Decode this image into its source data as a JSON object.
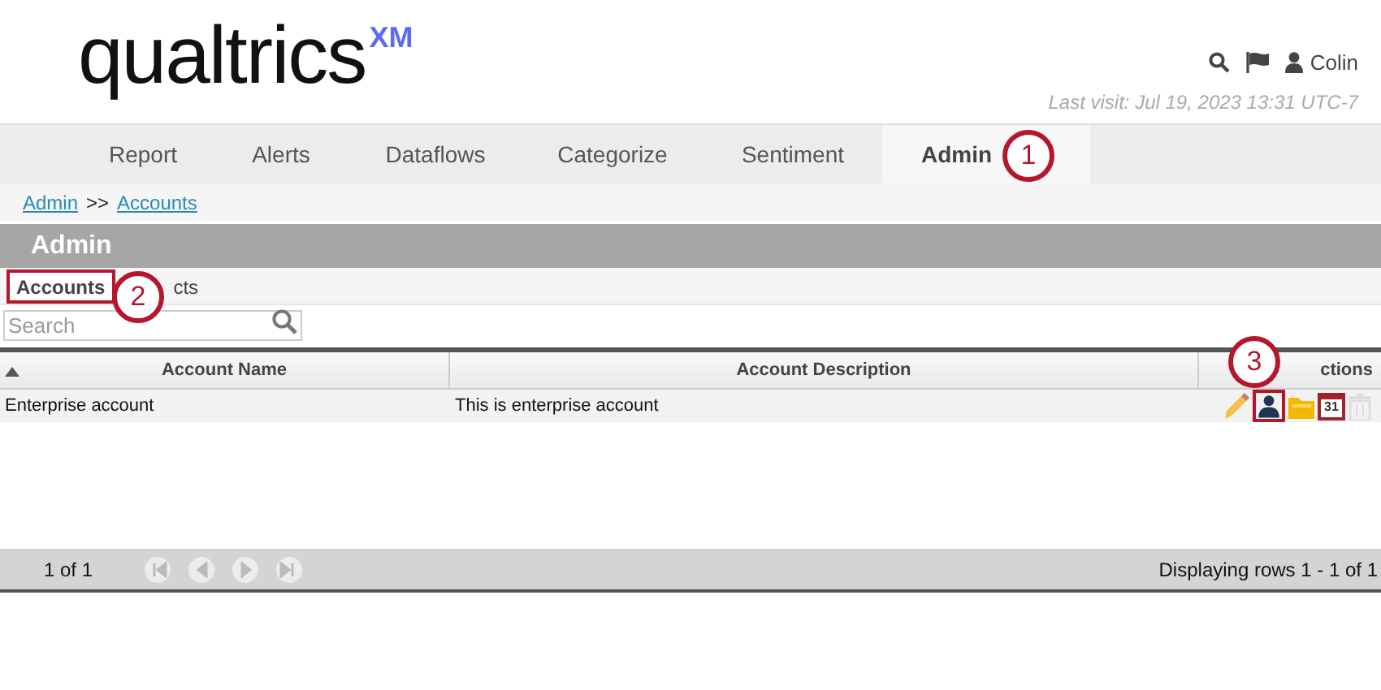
{
  "header": {
    "logo": "qualtrics",
    "logo_mark": "XM",
    "user": "Colin",
    "last_visit": "Last visit: Jul 19, 2023 13:31 UTC-7"
  },
  "nav_tabs": [
    {
      "label": "Report",
      "selected": false
    },
    {
      "label": "Alerts",
      "selected": false
    },
    {
      "label": "Dataflows",
      "selected": false
    },
    {
      "label": "Categorize",
      "selected": false
    },
    {
      "label": "Sentiment",
      "selected": false
    },
    {
      "label": "Admin",
      "selected": true
    }
  ],
  "breadcrumb": [
    "Admin",
    "Accounts"
  ],
  "breadcrumb_separator": ">>",
  "section_title": "Admin",
  "sub_tabs": [
    {
      "label": "Accounts",
      "selected": true
    },
    {
      "label": "cts",
      "selected": false
    }
  ],
  "search": {
    "placeholder": "Search"
  },
  "table": {
    "columns": [
      "Account Name",
      "Account Description",
      "ctions"
    ],
    "rows": [
      {
        "name": "Enterprise account",
        "description": "This is enterprise account",
        "calendar_day": "31"
      }
    ]
  },
  "pager": {
    "page": "1 of 1",
    "status": "Displaying rows 1 - 1 of 1"
  },
  "callouts": [
    "1",
    "2",
    "3"
  ]
}
